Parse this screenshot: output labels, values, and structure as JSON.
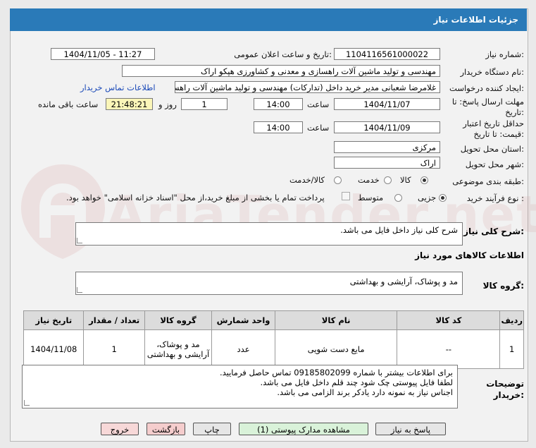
{
  "window": {
    "title": "جزئیات اطلاعات نیاز"
  },
  "watermark": {
    "text": "AriaTender.net"
  },
  "form": {
    "need_number": {
      "label": "شماره نیاز:",
      "value": "1104116561000022"
    },
    "announce_datetime": {
      "label": "تاریخ و ساعت اعلان عمومی:",
      "value": "1404/11/05 - 11:27"
    },
    "buyer_org": {
      "label": "نام دستگاه خریدار:",
      "value": "مهندسی و تولید ماشین آلات راهسازی و معدنی و کشاورزی هپکو اراک"
    },
    "requester": {
      "label": "ایجاد کننده درخواست:",
      "value": "غلامرضا شعبانی مدیر خرید داخل (تدارکات) مهندسی و تولید ماشین آلات راهسا",
      "link": "اطلاعات تماس خریدار"
    },
    "reply_deadline": {
      "label": "مهلت ارسال پاسخ: تا تاریخ:",
      "date": "1404/11/07",
      "time_label": "ساعت",
      "time": "14:00",
      "days": "1",
      "days_label": "روز و",
      "remaining": "21:48:21",
      "remaining_label": "ساعت باقی مانده"
    },
    "price_validity": {
      "label": "حداقل تاریخ اعتبار قیمت: تا تاریخ:",
      "date": "1404/11/09",
      "time_label": "ساعت",
      "time": "14:00"
    },
    "delivery_province": {
      "label": "استان محل تحویل:",
      "value": "مرکزی"
    },
    "delivery_city": {
      "label": "شهر محل تحویل:",
      "value": "اراک"
    },
    "category": {
      "label": "طبقه بندی موضوعی:",
      "options": [
        "کالا",
        "خدمت",
        "کالا/خدمت"
      ],
      "selected": "کالا"
    },
    "purchase_type": {
      "label": "نوع فرآیند خرید :",
      "options": [
        "جزیی",
        "متوسط"
      ],
      "selected": "جزیی",
      "note": "پرداخت تمام یا بخشی از مبلغ خرید،از محل \"اسناد خزانه اسلامی\" خواهد بود."
    }
  },
  "summary": {
    "label": "شرح کلی نیاز:",
    "value": "شرح کلی نیاز داخل فایل می باشد."
  },
  "goods_section": {
    "title": "اطلاعات کالاهای مورد نیاز"
  },
  "goods_group": {
    "label": "گروه کالا:",
    "value": "مد و پوشاک، آرایشی و بهداشتی"
  },
  "table": {
    "headers": [
      "ردیف",
      "کد کالا",
      "نام کالا",
      "واحد شمارش",
      "گروه کالا",
      "تعداد / مقدار",
      "تاریخ نیاز"
    ],
    "rows": [
      [
        "1",
        "--",
        "مایع دست شویی",
        "عدد",
        "مد و پوشاک، آرایشی و بهداشتی",
        "1",
        "1404/11/08"
      ]
    ]
  },
  "buyer_notes": {
    "label": "توضیحات خریدار:",
    "lines": [
      "برای اطلاعات بیشتر با شماره 09185802099 تماس حاصل فرمایید.",
      "لطفا فایل پیوستی چک شود چند قلم داخل فایل می باشد.",
      "اجناس نیاز به نمونه دارد یادکر برند الزامی می باشد."
    ]
  },
  "buttons": {
    "reply": "پاسخ به نیاز",
    "attachments": "مشاهده مدارک پیوستی (1)",
    "print": "چاپ",
    "back": "بازگشت",
    "exit": "خروج"
  }
}
